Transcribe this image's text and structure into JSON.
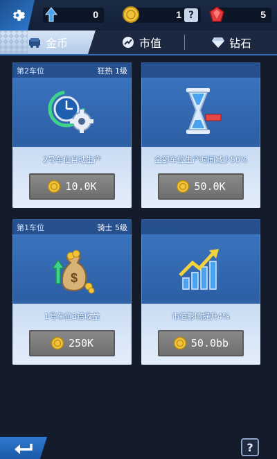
{
  "top_stats": {
    "rank_value": "0",
    "coin_value": "1",
    "gem_value": "5"
  },
  "tabs": [
    {
      "label": "金币",
      "icon": "car-seat-icon",
      "active": true
    },
    {
      "label": "市值",
      "icon": "market-icon",
      "active": false
    },
    {
      "label": "钻石",
      "icon": "diamond-icon",
      "active": false
    }
  ],
  "cards": [
    {
      "slot": "第2车位",
      "tag": "狂热 1级",
      "desc": "2号车位自动生产",
      "price": "10.0K",
      "icon": "clock-gear-icon"
    },
    {
      "slot": "",
      "tag": "",
      "desc": "全部车位生产时间减少50%",
      "price": "50.0K",
      "icon": "hourglass-icon"
    },
    {
      "slot": "第1车位",
      "tag": "骑士 5级",
      "desc": "1号车位3倍收益",
      "price": "250K",
      "icon": "money-bag-icon"
    },
    {
      "slot": "",
      "tag": "",
      "desc": "市值影响提升4%",
      "price": "50.0bb",
      "icon": "growth-chart-icon"
    }
  ],
  "help_label": "?",
  "colors": {
    "accent": "#2d7bd1",
    "coin": "#f2c23a",
    "gem": "#e33b3b"
  }
}
